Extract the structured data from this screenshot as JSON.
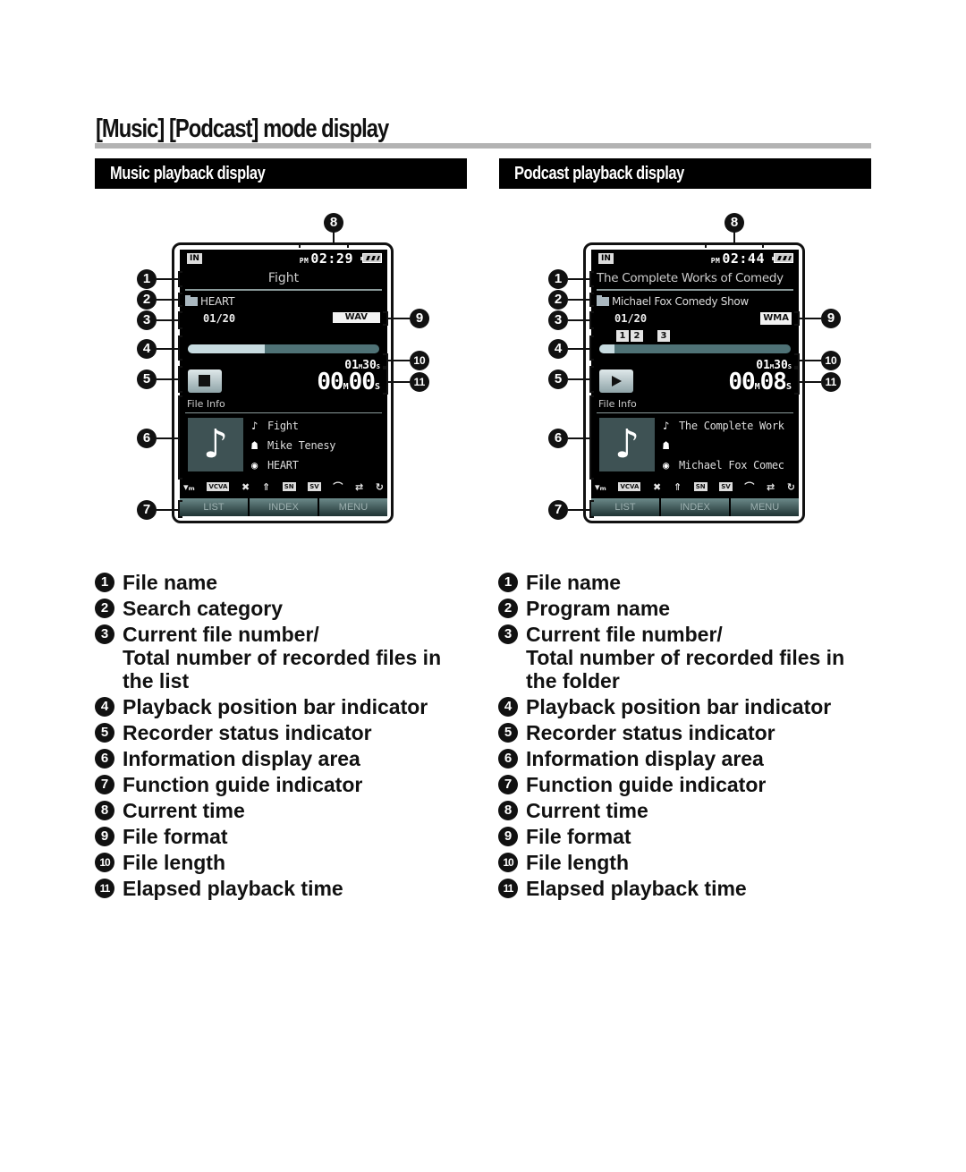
{
  "page": {
    "title": "[Music] [Podcast] mode display"
  },
  "music": {
    "section_title": "Music playback display",
    "screen": {
      "source_badge": "IN",
      "clock_ampm": "PM",
      "clock_time": "02:29",
      "battery_icon": "battery-icon",
      "file_name": "Fight",
      "category": "HEART",
      "file_number": "01/20",
      "format": "WAV",
      "progress_fraction": 0.4,
      "file_length": "01M30S",
      "file_length_min": "01",
      "file_length_sec": "30",
      "status": "stop",
      "elapsed_min": "00",
      "elapsed_sec": "00",
      "file_info_label": "File Info",
      "info": {
        "title": "Fight",
        "artist": "Mike Tenesy",
        "album": "HEART"
      },
      "function_buttons": [
        "LIST",
        "INDEX",
        "MENU"
      ]
    }
  },
  "podcast": {
    "section_title": "Podcast playback display",
    "screen": {
      "source_badge": "IN",
      "clock_ampm": "PM",
      "clock_time": "02:44",
      "battery_icon": "battery-icon",
      "file_name": "The Complete Works of Comedy",
      "program": "Michael Fox Comedy Show",
      "file_number": "01/20",
      "format": "WMA",
      "index_marks": [
        "1",
        "2",
        "3"
      ],
      "progress_fraction": 0.08,
      "file_length_min": "01",
      "file_length_sec": "30",
      "status": "play",
      "elapsed_min": "00",
      "elapsed_sec": "08",
      "file_info_label": "File Info",
      "info": {
        "title": "The Complete Work",
        "artist": "",
        "album": "Michael Fox Comec"
      },
      "function_buttons": [
        "LIST",
        "INDEX",
        "MENU"
      ]
    }
  },
  "status_icons": [
    "mic-sense-icon",
    "vcva-icon",
    "noise-cancel-icon",
    "zoom-mic-icon",
    "noise-sense-icon",
    "voice-filter-icon",
    "play-mode-icon",
    "skip-icon",
    "repeat-icon"
  ],
  "status_icon_labels": {
    "vcva": "VCVA",
    "sn": "SN",
    "sv": "SV"
  },
  "callouts": [
    "1",
    "2",
    "3",
    "4",
    "5",
    "6",
    "7",
    "8",
    "9",
    "10",
    "11"
  ],
  "legend_music": [
    {
      "num": "1",
      "text": "File name"
    },
    {
      "num": "2",
      "text": "Search category"
    },
    {
      "num": "3",
      "text": "Current file number/",
      "cont": [
        "Total number of recorded files in",
        "the list"
      ]
    },
    {
      "num": "4",
      "text": "Playback position bar indicator"
    },
    {
      "num": "5",
      "text": "Recorder status indicator"
    },
    {
      "num": "6",
      "text": "Information display area"
    },
    {
      "num": "7",
      "text": "Function guide indicator"
    },
    {
      "num": "8",
      "text": "Current time"
    },
    {
      "num": "9",
      "text": "File format"
    },
    {
      "num": "10",
      "text": "File length"
    },
    {
      "num": "11",
      "text": "Elapsed playback time"
    }
  ],
  "legend_podcast": [
    {
      "num": "1",
      "text": "File name"
    },
    {
      "num": "2",
      "text": "Program name"
    },
    {
      "num": "3",
      "text": "Current file number/",
      "cont": [
        "Total number of recorded files in",
        "the folder"
      ]
    },
    {
      "num": "4",
      "text": "Playback position bar indicator"
    },
    {
      "num": "5",
      "text": "Recorder status indicator"
    },
    {
      "num": "6",
      "text": "Information display area"
    },
    {
      "num": "7",
      "text": "Function guide indicator"
    },
    {
      "num": "8",
      "text": "Current time"
    },
    {
      "num": "9",
      "text": "File format"
    },
    {
      "num": "10",
      "text": "File length"
    },
    {
      "num": "11",
      "text": "Elapsed playback time"
    }
  ]
}
